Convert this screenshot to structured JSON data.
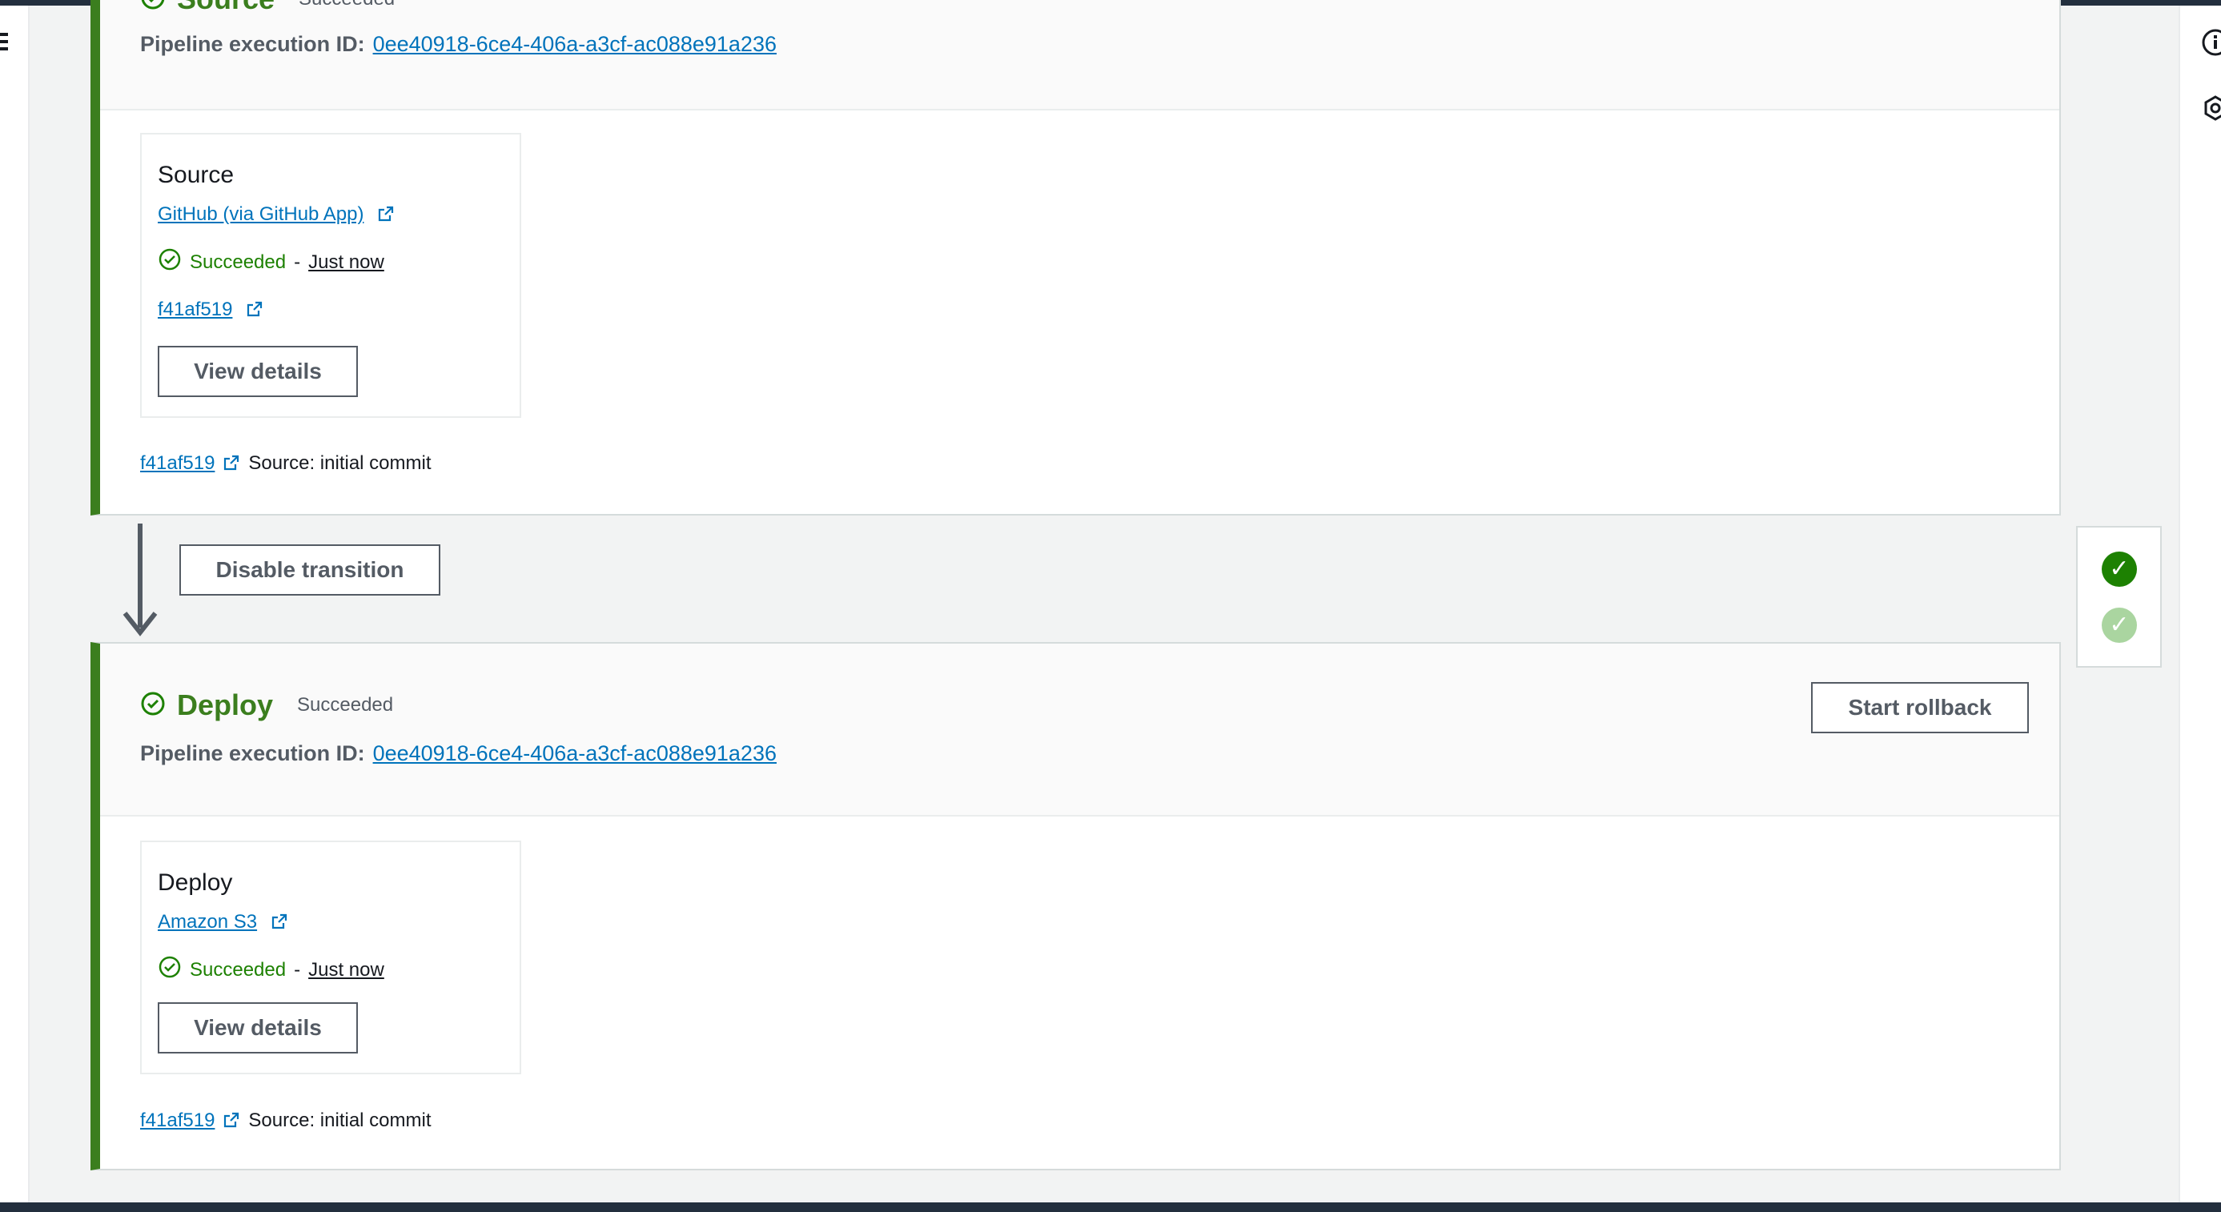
{
  "stages": [
    {
      "name": "Source",
      "status": "Succeeded",
      "exec_label": "Pipeline execution ID:",
      "exec_id": "0ee40918-6ce4-406a-a3cf-ac088e91a236",
      "action": {
        "name": "Source",
        "provider": "GitHub (via GitHub App)",
        "status": "Succeeded",
        "dash": "-",
        "time": "Just now",
        "revision": "f41af519",
        "view_details_label": "View details"
      },
      "commit": {
        "id": "f41af519",
        "message": "Source: initial commit"
      }
    },
    {
      "name": "Deploy",
      "status": "Succeeded",
      "rollback_label": "Start rollback",
      "exec_label": "Pipeline execution ID:",
      "exec_id": "0ee40918-6ce4-406a-a3cf-ac088e91a236",
      "action": {
        "name": "Deploy",
        "provider": "Amazon S3",
        "status": "Succeeded",
        "dash": "-",
        "time": "Just now",
        "view_details_label": "View details"
      },
      "commit": {
        "id": "f41af519",
        "message": "Source: initial commit"
      }
    }
  ],
  "transition": {
    "button_label": "Disable transition"
  },
  "colors": {
    "success": "#1d8102",
    "stage_border": "#3b7e1e",
    "link": "#0073bb"
  },
  "icons": [
    "menu-icon",
    "info-icon",
    "settings-icon",
    "check-circle-icon",
    "external-link-icon",
    "down-arrow-icon"
  ]
}
